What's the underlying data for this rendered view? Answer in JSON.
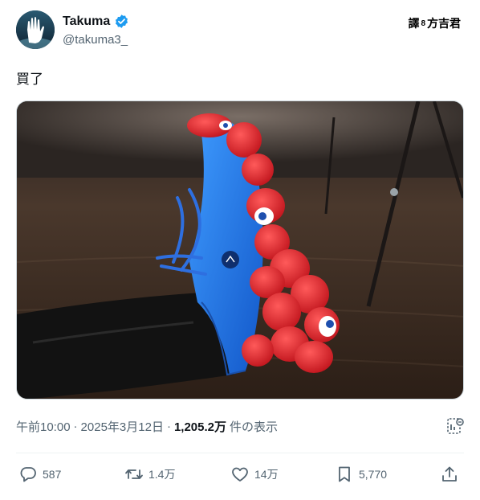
{
  "author": {
    "display_name": "Takuma",
    "handle": "@takuma3_",
    "verified": true,
    "verified_color": "#1d9bf0"
  },
  "watermark": {
    "prefix": "譯",
    "separator": "8",
    "name": "方吉君"
  },
  "tweet": {
    "text": "買了"
  },
  "meta": {
    "time": "午前10:00",
    "dot1": "·",
    "date": "2025年3月12日",
    "dot2": "·",
    "views": "1,205.2万",
    "views_label": "件の表示"
  },
  "actions": {
    "reply_count": "587",
    "retweet_count": "1.4万",
    "like_count": "14万",
    "bookmark_count": "5,770"
  },
  "icons": {
    "reply": "reply-icon",
    "retweet": "retweet-icon",
    "like": "heart-icon",
    "bookmark": "bookmark-icon",
    "share": "share-icon",
    "analytics": "analytics-icon",
    "verified": "verified-badge-icon"
  },
  "colors": {
    "text_primary": "#0f1419",
    "text_secondary": "#536471",
    "shoe_blue": "#1e7be8",
    "sole_red": "#e0262e"
  }
}
